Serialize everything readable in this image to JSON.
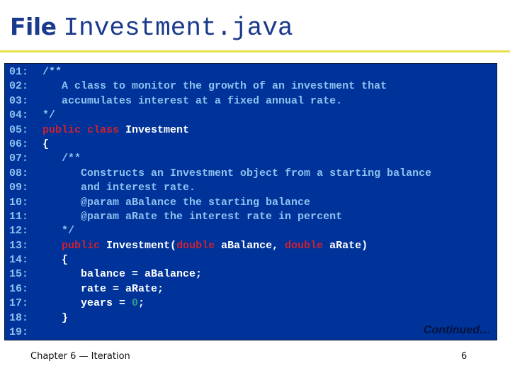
{
  "header": {
    "label": "File",
    "filename": "Investment.java"
  },
  "code": {
    "lines": [
      {
        "num": "01:",
        "parts": [
          {
            "t": "/**",
            "c": "cmt"
          }
        ]
      },
      {
        "num": "02:",
        "parts": [
          {
            "t": "   A class to monitor the growth of an investment that",
            "c": "cmt"
          }
        ]
      },
      {
        "num": "03:",
        "parts": [
          {
            "t": "   accumulates interest at a fixed annual rate.",
            "c": "cmt"
          }
        ]
      },
      {
        "num": "04:",
        "parts": [
          {
            "t": "*/",
            "c": "cmt"
          }
        ]
      },
      {
        "num": "05:",
        "parts": [
          {
            "t": "public class",
            "c": "kw"
          },
          {
            "t": " Investment",
            "c": "txt"
          }
        ]
      },
      {
        "num": "06:",
        "parts": [
          {
            "t": "{",
            "c": "txt"
          }
        ]
      },
      {
        "num": "07:",
        "parts": [
          {
            "t": "   /**",
            "c": "cmt"
          }
        ]
      },
      {
        "num": "08:",
        "parts": [
          {
            "t": "      Constructs an Investment object from a starting balance",
            "c": "cmt"
          }
        ]
      },
      {
        "num": "09:",
        "parts": [
          {
            "t": "      and interest rate.",
            "c": "cmt"
          }
        ]
      },
      {
        "num": "10:",
        "parts": [
          {
            "t": "      @param aBalance the starting balance",
            "c": "cmt"
          }
        ]
      },
      {
        "num": "11:",
        "parts": [
          {
            "t": "      @param aRate the interest rate in percent",
            "c": "cmt"
          }
        ]
      },
      {
        "num": "12:",
        "parts": [
          {
            "t": "   */",
            "c": "cmt"
          }
        ]
      },
      {
        "num": "13:",
        "parts": [
          {
            "t": "   ",
            "c": "txt"
          },
          {
            "t": "public",
            "c": "kw"
          },
          {
            "t": " Investment(",
            "c": "txt"
          },
          {
            "t": "double",
            "c": "kw"
          },
          {
            "t": " aBalance, ",
            "c": "txt"
          },
          {
            "t": "double",
            "c": "kw"
          },
          {
            "t": " aRate)",
            "c": "txt"
          }
        ]
      },
      {
        "num": "14:",
        "parts": [
          {
            "t": "   {",
            "c": "txt"
          }
        ]
      },
      {
        "num": "15:",
        "parts": [
          {
            "t": "      balance = aBalance;",
            "c": "txt"
          }
        ]
      },
      {
        "num": "16:",
        "parts": [
          {
            "t": "      rate = aRate;",
            "c": "txt"
          }
        ]
      },
      {
        "num": "17:",
        "parts": [
          {
            "t": "      years = ",
            "c": "txt"
          },
          {
            "t": "0",
            "c": "lit"
          },
          {
            "t": ";",
            "c": "txt"
          }
        ]
      },
      {
        "num": "18:",
        "parts": [
          {
            "t": "   }",
            "c": "txt"
          }
        ]
      },
      {
        "num": "19:",
        "parts": []
      }
    ],
    "continued": "Continued…"
  },
  "footer": {
    "chapter": "Chapter 6 — Iteration",
    "page": "6"
  },
  "colors": {
    "code_bg": "#003399",
    "comment": "#8ec1f0",
    "keyword": "#cc2233",
    "text": "#ffffff",
    "literal": "#2e9a8a",
    "rule": "#e6e04a",
    "title": "#1a3a8c"
  }
}
